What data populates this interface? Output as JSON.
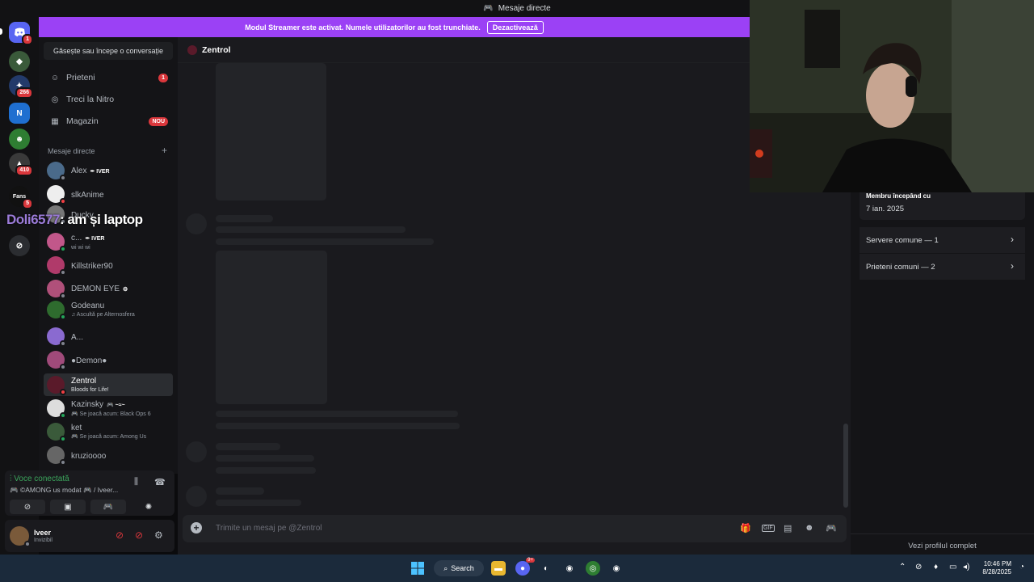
{
  "window": {
    "title": "Mesaje directe",
    "title_icon": "discord-icon"
  },
  "banner": {
    "text": "Modul Streamer este activat. Numele utilizatorilor au fost trunchiate.",
    "button": "Dezactivează"
  },
  "servers": [
    {
      "icon": "discord-icon",
      "badge": "1",
      "color": "#5865f2"
    },
    {
      "icon": "game-icon",
      "badge": "",
      "color": "#3a5a3a"
    },
    {
      "icon": "server-icon",
      "badge": "266",
      "color": "#233a6a"
    },
    {
      "icon": "n-icon",
      "label": "N",
      "badge": "",
      "color": "#1f6fd0"
    },
    {
      "icon": "green-face-icon",
      "badge": "",
      "color": "#2e7d32"
    },
    {
      "icon": "rooster-icon",
      "badge": "410",
      "color": "#3a3a3a"
    },
    {
      "icon": "fans-icon",
      "label": "Fans",
      "badge": "5",
      "color": "#111111"
    },
    {
      "icon": "discover-icon",
      "badge": "",
      "color": "#2b2d31"
    }
  ],
  "sidebar": {
    "search": "Găsește sau începe o conversație",
    "nav": [
      {
        "label": "Prieteni",
        "icon": "friends-icon",
        "badge": "1"
      },
      {
        "label": "Treci la Nitro",
        "icon": "nitro-icon",
        "badge": ""
      },
      {
        "label": "Magazin",
        "icon": "shop-icon",
        "badge": "NOU"
      }
    ],
    "dm_header": "Mesaje directe",
    "dm_add": "+",
    "dms": [
      {
        "name": "Alex",
        "tag": "✒ IVER",
        "sub": "",
        "color": "#4a6a8a",
        "status": "#80848e"
      },
      {
        "name": "slkAnime",
        "tag": "",
        "sub": "",
        "color": "#eeeeee",
        "status": "#f23f43"
      },
      {
        "name": "Ducky",
        "tag": "",
        "sub": "",
        "color": "#777777",
        "status": "#80848e"
      },
      {
        "name": "c...",
        "tag": "✒ IVER",
        "sub": "wi wi wi",
        "color": "#c2578a",
        "status": "#23a55a"
      },
      {
        "name": "Killstriker90",
        "tag": "",
        "sub": "",
        "color": "#b03a6a",
        "status": "#80848e"
      },
      {
        "name": "DEMON EYE",
        "tag": "⚙",
        "sub": "",
        "color": "#b0507a",
        "status": "#80848e"
      },
      {
        "name": "Godeanu",
        "tag": "",
        "sub": "♫ Ascultă pe Alternosfera",
        "color": "#2e6b2e",
        "status": "#23a55a"
      },
      {
        "name": "A...",
        "tag": "",
        "sub": "",
        "color": "#8a6ad0",
        "status": "#80848e"
      },
      {
        "name": "●Demon●",
        "tag": "",
        "sub": "",
        "color": "#a04a7a",
        "status": "#80848e"
      },
      {
        "name": "Zentrol",
        "tag": "",
        "sub": "Bloods for Life!",
        "color": "#5a1a2a",
        "status": "#f23f43"
      },
      {
        "name": "Kazinsky",
        "tag": "🎮 ~≈~",
        "sub": "🎮 Se joacă acum: Black Ops 6",
        "color": "#dddddd",
        "status": "#23a55a"
      },
      {
        "name": "ket",
        "tag": "",
        "sub": "🎮 Se joacă acum: Among Us",
        "color": "#3a5a3a",
        "status": "#23a55a"
      },
      {
        "name": "kruzioooo",
        "tag": "",
        "sub": "",
        "color": "#666666",
        "status": "#80848e"
      }
    ]
  },
  "stream_overlay": {
    "user": "Doli6577",
    "message": ": am și laptop"
  },
  "voice": {
    "status": "Voce conectată",
    "channel": "🎮 ©AMONG us modat 🎮 / Iveer...",
    "buttons": [
      "camera-off-icon",
      "screen-share-icon",
      "activity-icon",
      "soundboard-icon"
    ]
  },
  "user": {
    "name": "Iveer",
    "status": "Invizibil"
  },
  "chat": {
    "recipient": "Zentrol",
    "placeholder": "Trimite un mesaj pe @Zentrol"
  },
  "profile": {
    "member_since_label": "Membru începând cu",
    "member_since": "7 ian. 2025",
    "mutual_servers": "Servere comune — 1",
    "mutual_friends": "Prieteni comuni — 2",
    "view_full": "Vezi profilul complet"
  },
  "taskbar": {
    "search": "Search",
    "time": "10:46 PM",
    "date": "8/28/2025",
    "discord_badge": "9+"
  }
}
